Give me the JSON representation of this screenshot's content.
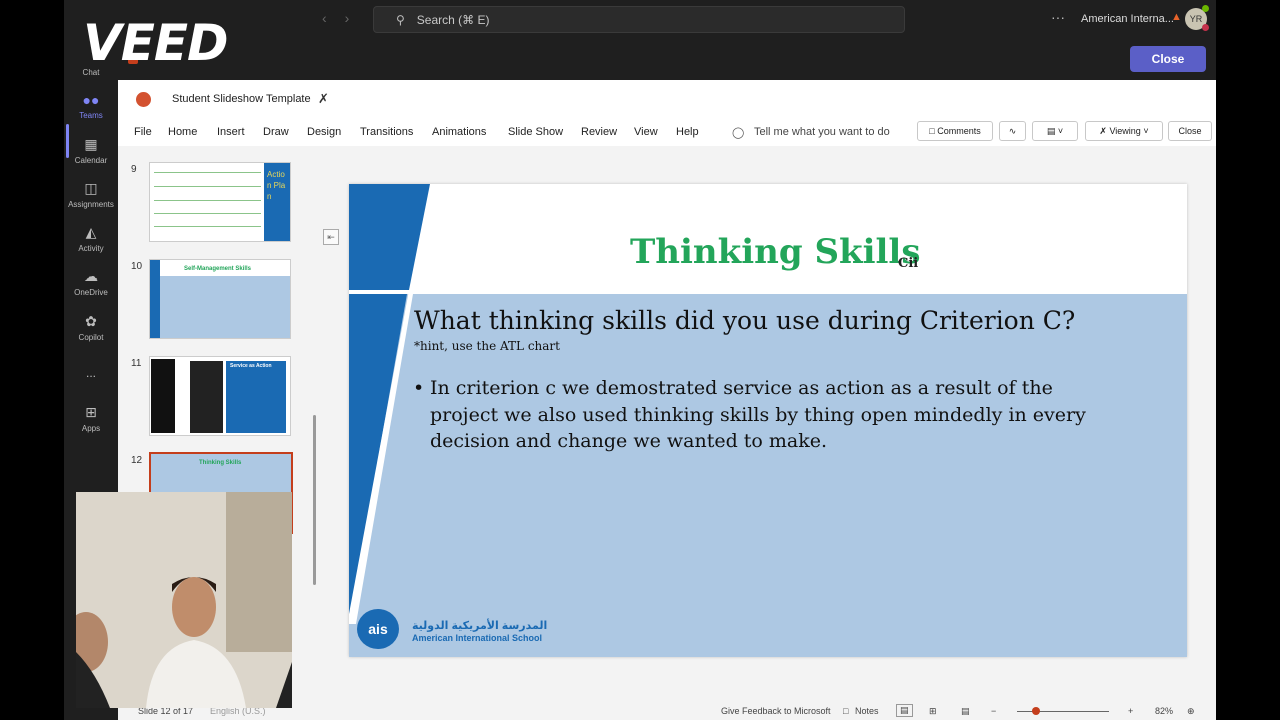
{
  "watermark": "VEED",
  "topbar": {
    "search_placeholder": "Search (⌘ E)",
    "org_name": "American Interna...",
    "avatar_initials": "YR"
  },
  "rail": [
    {
      "label": "Chat"
    },
    {
      "label": "Teams"
    },
    {
      "label": "Calendar"
    },
    {
      "label": "Assignments"
    },
    {
      "label": "Activity"
    },
    {
      "label": "OneDrive"
    },
    {
      "label": "Copilot"
    },
    {
      "label": "..."
    },
    {
      "label": "Apps"
    }
  ],
  "header": {
    "close_label": "Close"
  },
  "ppt": {
    "doc_name": "Student Slideshow Template",
    "menu": [
      "File",
      "Home",
      "Insert",
      "Draw",
      "Design",
      "Transitions",
      "Animations",
      "Slide Show",
      "Review",
      "View",
      "Help"
    ],
    "tell_me": "Tell me what you want to do",
    "comments_label": "Comments",
    "viewing_label": "Viewing",
    "close_label": "Close"
  },
  "thumbnails": [
    {
      "number": "9",
      "side_text": "Action Plan"
    },
    {
      "number": "10",
      "title": "Self-Management Skills"
    },
    {
      "number": "11",
      "title": "Service as Action"
    },
    {
      "number": "12",
      "title": "Thinking Skills"
    }
  ],
  "slide": {
    "title": "Thinking Skills",
    "criterion": "Cii",
    "question": "What thinking skills did you use during Criterion C?",
    "hint": "*hint, use the ATL chart",
    "bullet": "In criterion c we demostrated service as action as a result of the project we also used thinking skills by thing open mindedly in every decision and change we wanted to make.",
    "school_ar": "المدرسة الأمريكية الدولية",
    "school_en": "American International School",
    "logo_text": "ais"
  },
  "status": {
    "slide_counter": "Slide 12 of 17",
    "language": "English (U.S.)",
    "feedback": "Give Feedback to Microsoft",
    "notes": "Notes",
    "zoom": "82%"
  },
  "colors": {
    "accent": "#5b5fc7",
    "slide_blue": "#1a6ab3",
    "title_green": "#23a55a"
  }
}
